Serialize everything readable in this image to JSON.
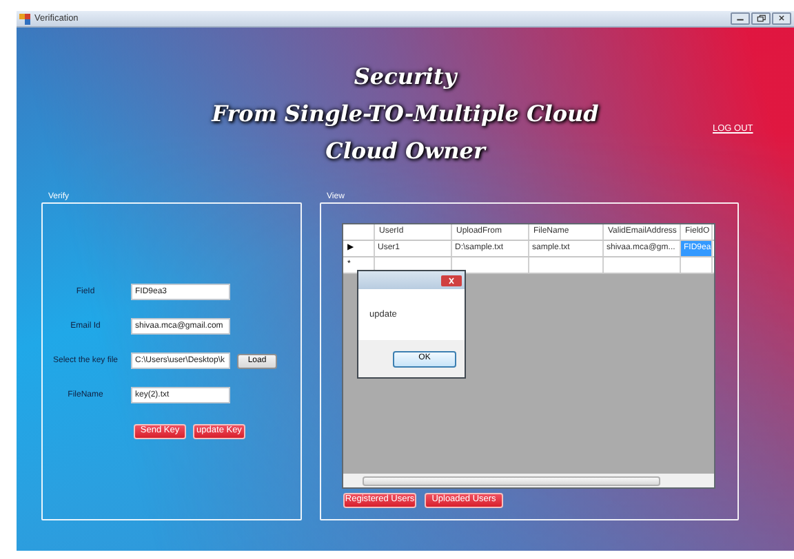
{
  "window": {
    "title": "Verification"
  },
  "header": {
    "lines": [
      "Security",
      "From Single-TO-Multiple Cloud",
      "Cloud Owner"
    ],
    "logout": "LOG OUT"
  },
  "verify": {
    "legend": "Verify",
    "fields": [
      {
        "label": "FieId",
        "value": "FID9ea3"
      },
      {
        "label": "Email Id",
        "value": "shivaa.mca@gmail.com"
      },
      {
        "label": "Select the key file",
        "value": "C:\\Users\\user\\Desktop\\k",
        "button": "Load"
      },
      {
        "label": "FileName",
        "value": "key(2).txt"
      }
    ],
    "buttons": [
      "Send Key",
      "update Key"
    ]
  },
  "view": {
    "legend": "View",
    "table": {
      "columns": [
        "UserId",
        "UploadFrom",
        "FileName",
        "ValidEmailAddress",
        "FieldO"
      ],
      "rows": [
        {
          "marker": "▶",
          "cells": [
            "User1",
            "D:\\sample.txt",
            "sample.txt",
            "shivaa.mca@gm...",
            "FID9ea"
          ]
        },
        {
          "marker": "*",
          "cells": [
            "",
            "",
            "",
            "",
            ""
          ]
        }
      ]
    },
    "buttons": [
      "Registered Users",
      "Uploaded Users"
    ]
  },
  "dialog": {
    "message": "update",
    "button": "OK"
  }
}
